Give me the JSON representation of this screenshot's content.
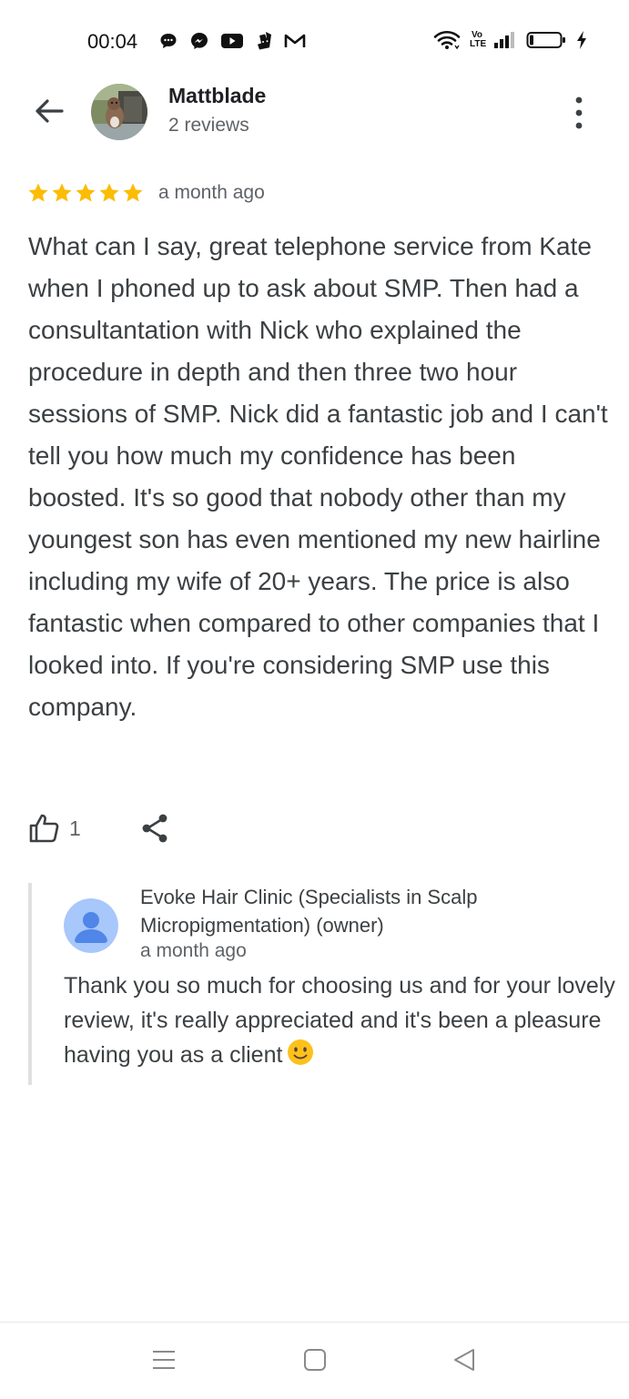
{
  "status_bar": {
    "time": "00:04",
    "left_icons": [
      "chat-icon",
      "messenger-icon",
      "youtube-icon",
      "deliveroo-icon",
      "gmail-icon"
    ],
    "right_icons": [
      "wifi-icon",
      "volte-icon",
      "signal-icon",
      "battery-icon",
      "charging-icon"
    ],
    "volte_label": "Vo LTE"
  },
  "header": {
    "name": "Mattblade",
    "reviews": "2 reviews"
  },
  "review": {
    "stars": 5,
    "star_color": "#fbbc04",
    "date": "a month ago",
    "text": "What can I say, great telephone service from Kate when I phoned up to ask about SMP. Then had a consultantation with Nick who explained the procedure in depth and then three two hour sessions of SMP. Nick did a fantastic job and I can't tell you how much my confidence has been boosted. It's so good that nobody other than my youngest son has even mentioned my new hairline including my wife of 20+ years. The price is also fantastic when compared to other companies that I looked into. If you're considering SMP use this company.",
    "likes": "1"
  },
  "owner_reply": {
    "name": "Evoke Hair Clinic (Specialists in Scalp Micropigmentation) (owner)",
    "date": "a month ago",
    "text": "Thank you so much for choosing us and for your lovely review, it's really appreciated and it's been a pleasure having you as a client",
    "emoji": "slightly-smiling-face"
  },
  "nav_bar": {
    "buttons": [
      "menu-icon",
      "home-icon",
      "back-triangle-icon"
    ]
  }
}
